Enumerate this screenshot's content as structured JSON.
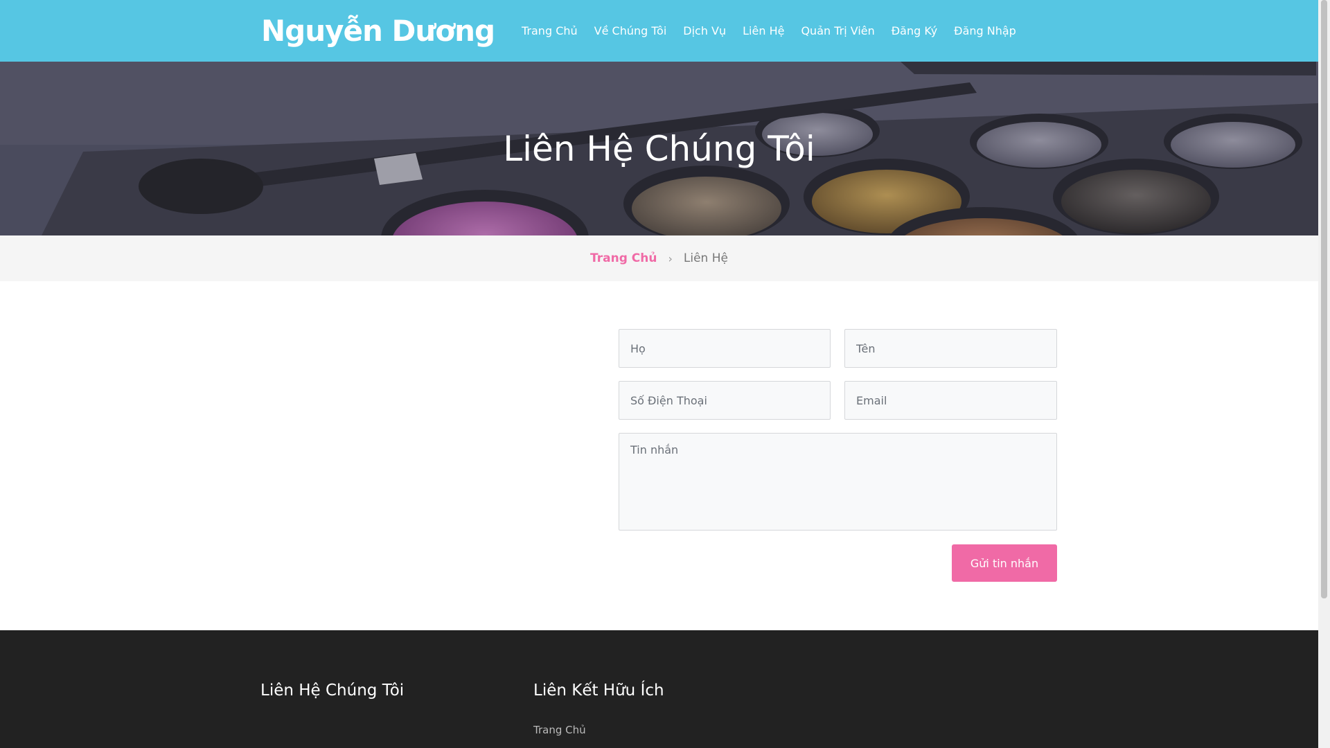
{
  "header": {
    "logo": "Nguyễn Dương",
    "nav": [
      "Trang Chủ",
      "Về Chúng Tôi",
      "Dịch Vụ",
      "Liên Hệ",
      "Quản Trị Viên",
      "Đăng Ký",
      "Đăng Nhập"
    ]
  },
  "hero": {
    "title": "Liên Hệ Chúng Tôi"
  },
  "breadcrumb": {
    "home": "Trang Chủ",
    "separator": "›",
    "current": "Liên Hệ"
  },
  "form": {
    "last_name_placeholder": "Họ",
    "first_name_placeholder": "Tên",
    "phone_placeholder": "Số Điện Thoại",
    "email_placeholder": "Email",
    "message_placeholder": "Tin nhắn",
    "submit_label": "Gửi tin nhắn"
  },
  "footer": {
    "contact_heading": "Liên Hệ Chúng Tôi",
    "links_heading": "Liên Kết Hữu Ích",
    "links": [
      "Trang Chủ"
    ]
  },
  "colors": {
    "header_bg": "#56c6e3",
    "accent": "#f06aa6",
    "footer_bg": "#222222"
  }
}
